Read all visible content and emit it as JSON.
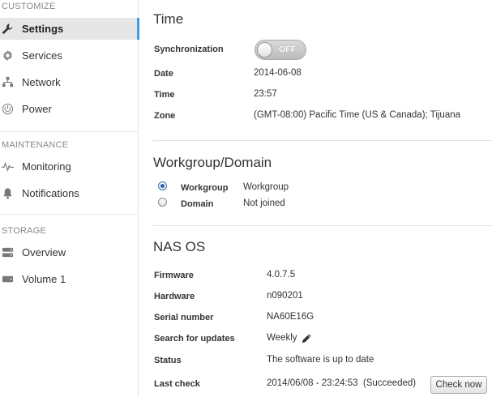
{
  "sidebar": {
    "sections": [
      {
        "title": "CUSTOMIZE",
        "items": [
          {
            "label": "Settings",
            "icon": "wrench-icon",
            "active": true
          },
          {
            "label": "Services",
            "icon": "gear-icon"
          },
          {
            "label": "Network",
            "icon": "network-icon"
          },
          {
            "label": "Power",
            "icon": "power-icon"
          }
        ]
      },
      {
        "title": "MAINTENANCE",
        "items": [
          {
            "label": "Monitoring",
            "icon": "pulse-icon"
          },
          {
            "label": "Notifications",
            "icon": "bell-icon"
          }
        ]
      },
      {
        "title": "STORAGE",
        "items": [
          {
            "label": "Overview",
            "icon": "storage-icon"
          },
          {
            "label": "Volume 1",
            "icon": "disk-icon"
          }
        ]
      }
    ]
  },
  "time": {
    "title": "Time",
    "sync_label": "Synchronization",
    "sync_state": "OFF",
    "date_label": "Date",
    "date_value": "2014-06-08",
    "time_label": "Time",
    "time_value": "23:57",
    "zone_label": "Zone",
    "zone_value": "(GMT-08:00) Pacific Time (US & Canada); Tijuana"
  },
  "workgroup": {
    "title": "Workgroup/Domain",
    "options": [
      {
        "label": "Workgroup",
        "value": "Workgroup",
        "checked": true
      },
      {
        "label": "Domain",
        "value": "Not joined",
        "checked": false
      }
    ]
  },
  "nas": {
    "title": "NAS OS",
    "firmware_label": "Firmware",
    "firmware_value": "4.0.7.5",
    "hardware_label": "Hardware",
    "hardware_value": "n090201",
    "serial_label": "Serial number",
    "serial_value": "NA60E16G",
    "updates_label": "Search for updates",
    "updates_value": "Weekly",
    "status_label": "Status",
    "status_value": "The software is up to date",
    "lastcheck_label": "Last check",
    "lastcheck_value": "2014/06/08 - 23:24:53  (Succeeded)",
    "check_button": "Check now"
  },
  "colors": {
    "accent": "#3f9de6",
    "radio_selected": "#2b63b3"
  }
}
